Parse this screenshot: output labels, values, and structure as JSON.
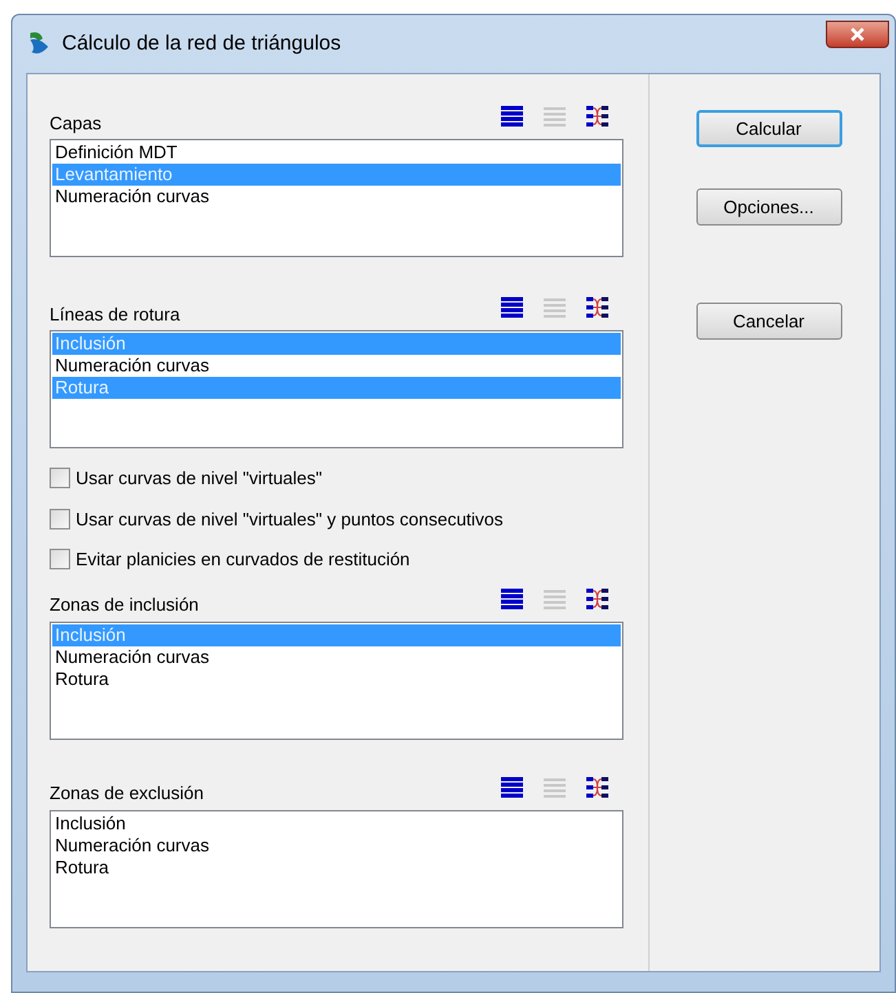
{
  "window": {
    "title": "Cálculo de la red de triángulos"
  },
  "sections": [
    {
      "kind": "list",
      "label": "Capas",
      "items": [
        {
          "label": "Definición MDT",
          "selected": false
        },
        {
          "label": "Levantamiento",
          "selected": true
        },
        {
          "label": "Numeración curvas",
          "selected": false
        }
      ]
    },
    {
      "kind": "list",
      "label": "Líneas de rotura",
      "items": [
        {
          "label": "Inclusión",
          "selected": true
        },
        {
          "label": "Numeración curvas",
          "selected": false
        },
        {
          "label": "Rotura",
          "selected": true
        }
      ]
    },
    {
      "kind": "checkbox",
      "label": "Usar curvas de nivel \"virtuales\"",
      "checked": false
    },
    {
      "kind": "checkbox",
      "label": "Usar curvas de nivel \"virtuales\" y puntos consecutivos",
      "checked": false
    },
    {
      "kind": "checkbox",
      "label": "Evitar planicies en curvados de restitución",
      "checked": false
    },
    {
      "kind": "list",
      "label": "Zonas de inclusión",
      "items": [
        {
          "label": "Inclusión",
          "selected": true
        },
        {
          "label": "Numeración curvas",
          "selected": false
        },
        {
          "label": "Rotura",
          "selected": false
        }
      ]
    },
    {
      "kind": "list",
      "label": "Zonas de exclusión",
      "items": [
        {
          "label": "Inclusión",
          "selected": false
        },
        {
          "label": "Numeración curvas",
          "selected": false
        },
        {
          "label": "Rotura",
          "selected": false
        }
      ]
    }
  ],
  "buttons": [
    {
      "label": "Calcular",
      "default": true
    },
    {
      "label": "Opciones...",
      "default": false
    },
    {
      "label": "Cancelar",
      "default": false
    }
  ]
}
